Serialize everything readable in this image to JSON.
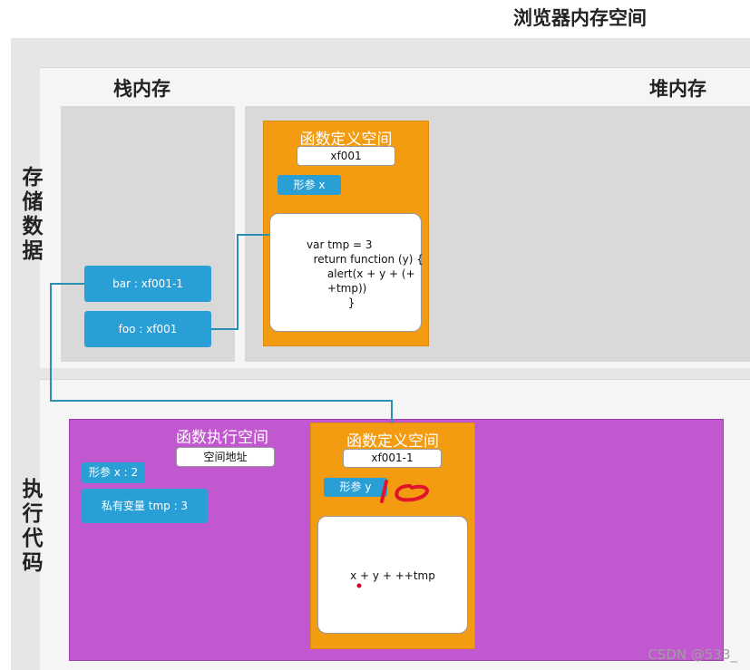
{
  "title": "浏览器内存空间",
  "sections": {
    "stack": "栈内存",
    "heap": "堆内存",
    "store": "存储数据",
    "exec": "执行代码"
  },
  "heap_func": {
    "title": "函数定义空间",
    "address": "xf001",
    "param": "形参 x",
    "code": "var tmp = 3\n  return function (y) {\n      alert(x + y + (+\n      +tmp))\n            }"
  },
  "stack_vars": {
    "bar": "bar :  xf001-1",
    "foo": "foo : xf001"
  },
  "exec_space": {
    "title": "函数执行空间",
    "address": "空间地址",
    "param": "形参 x : 2",
    "private_var": "私有变量 tmp : 3"
  },
  "inner_func": {
    "title": "函数定义空间",
    "address": "xf001-1",
    "param": "形参 y",
    "annotation": "10",
    "code": "x + y + ++tmp"
  },
  "watermark": "CSDN @533_",
  "colors": {
    "orange": "#f39c12",
    "purple": "#c158cf",
    "blue": "#2a9fd6",
    "teal_line": "#2a8fb0",
    "annotation_red": "#e0142a"
  }
}
